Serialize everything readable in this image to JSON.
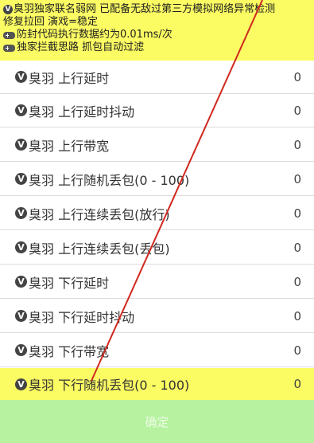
{
  "banner": {
    "line1": "臭羽独家联名弱网 已配备无敌过第三方模拟网络异常检测",
    "line2": "修复拉回 演戏=稳定",
    "line3": "防封代码执行数据约为0.01ms/次",
    "line4": "独家拦截思路 抓包自动过滤"
  },
  "rows": [
    {
      "label": "臭羽 上行延时",
      "value": "0"
    },
    {
      "label": "臭羽 上行延时抖动",
      "value": "0"
    },
    {
      "label": "臭羽 上行带宽",
      "value": "0"
    },
    {
      "label": "臭羽 上行随机丢包(0 - 100)",
      "value": "0"
    },
    {
      "label": "臭羽 上行连续丢包(放行)",
      "value": "0"
    },
    {
      "label": "臭羽 上行连续丢包(丢包)",
      "value": "0"
    },
    {
      "label": "臭羽 下行延时",
      "value": "0"
    },
    {
      "label": "臭羽 下行延时抖动",
      "value": "0"
    },
    {
      "label": "臭羽 下行带宽",
      "value": "0"
    },
    {
      "label": "臭羽 下行随机丢包(0 - 100)",
      "value": "0"
    }
  ],
  "bottom": {
    "button_label": "确定"
  },
  "colors": {
    "banner": "#fbfb63",
    "bottom_bar": "#b6f2a0",
    "stroke": "#d0281e"
  },
  "icons": {
    "row_badge": "v-badge-icon",
    "gamepad": "gamepad-icon"
  }
}
